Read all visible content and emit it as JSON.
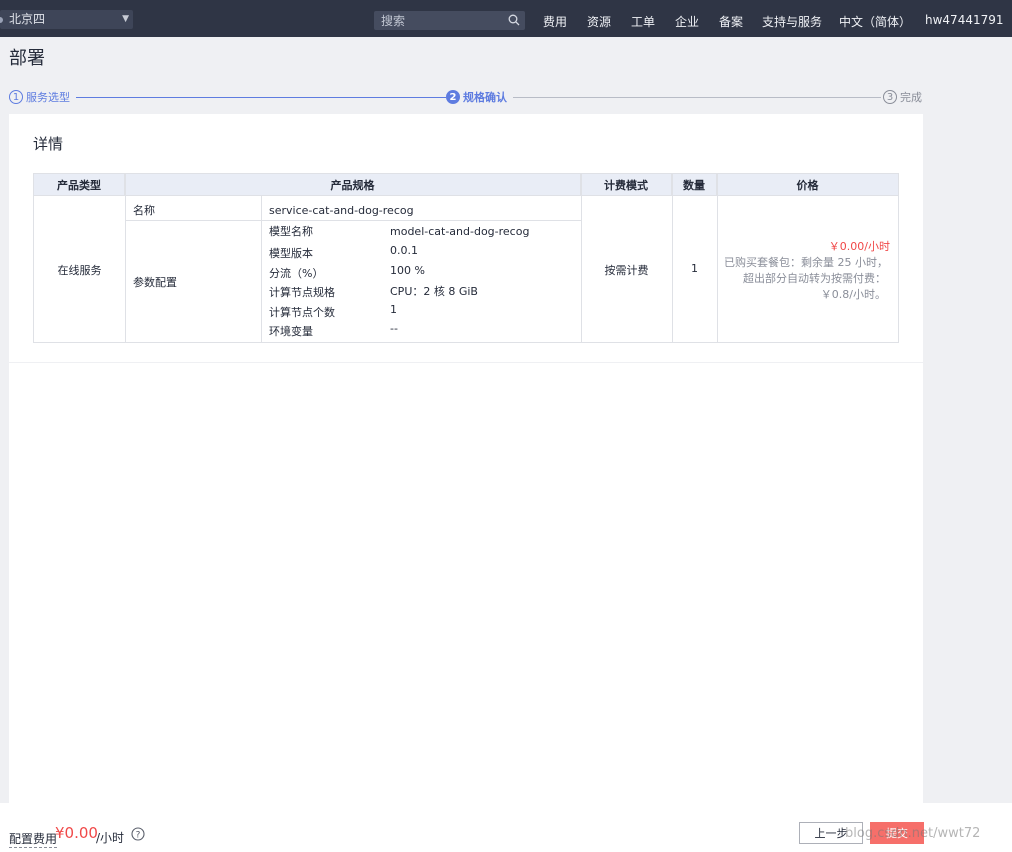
{
  "topbar": {
    "region": "北京四",
    "search_placeholder": "搜索",
    "nav": [
      "费用",
      "资源",
      "工单",
      "企业",
      "备案",
      "支持与服务",
      "中文（简体）",
      "hw47441791"
    ]
  },
  "page_title": "部署",
  "steps": [
    {
      "num": "1",
      "label": "服务选型",
      "state": "done"
    },
    {
      "num": "2",
      "label": "规格确认",
      "state": "active"
    },
    {
      "num": "3",
      "label": "完成",
      "state": "pending"
    }
  ],
  "card": {
    "title": "详情",
    "headers": [
      "产品类型",
      "产品规格",
      "计费模式",
      "数量",
      "价格"
    ],
    "product_type": "在线服务",
    "name_label": "名称",
    "name_value": "service-cat-and-dog-recog",
    "params_label": "参数配置",
    "params": [
      {
        "key": "模型名称",
        "value": "model-cat-and-dog-recog"
      },
      {
        "key": "模型版本",
        "value": "0.0.1"
      },
      {
        "key": "分流（%）",
        "value": "100 %"
      },
      {
        "key": "计算节点规格",
        "value": "CPU：2 核 8 GiB"
      },
      {
        "key": "计算节点个数",
        "value": "1"
      },
      {
        "key": "环境变量",
        "value": "--"
      }
    ],
    "billing_mode": "按需计费",
    "quantity": "1",
    "price": "￥0.00/小时",
    "price_note": [
      "已购买套餐包：剩余量 25 小时，",
      "超出部分自动转为按需付费：",
      "￥0.8/小时。"
    ]
  },
  "footer": {
    "fee_label": "配置费用",
    "fee_value": "¥0.00",
    "fee_unit": "/小时",
    "prev_label": "上一步",
    "submit_label": "提交",
    "watermark": "blog.csdn.net/wwt72"
  },
  "colors": {
    "topbar": "#2f3545",
    "accent": "#5e7ce0",
    "price": "#f04848",
    "submit": "#f66f6a"
  }
}
